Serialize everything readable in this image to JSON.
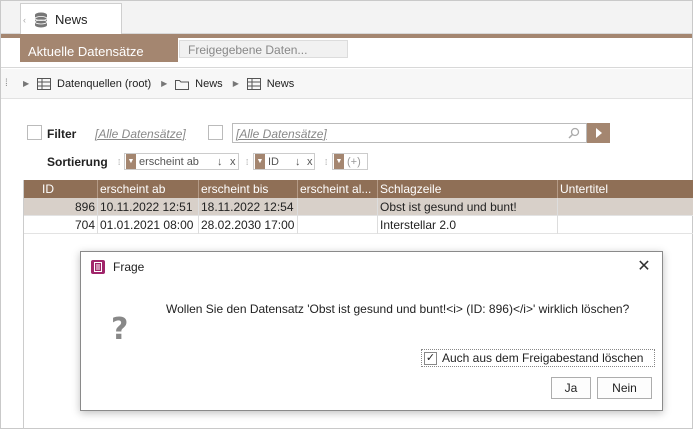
{
  "tab": {
    "label": "News"
  },
  "subtabs": {
    "active": "Aktuelle Datensätze",
    "inactive": "Freigegebene Daten..."
  },
  "breadcrumb": {
    "root": "Datenquellen (root)",
    "folder": "News",
    "table": "News"
  },
  "filter": {
    "label": "Filter",
    "dropdown_value": "[Alle Datensätze]",
    "search_value": "[Alle Datensätze]"
  },
  "sort": {
    "label": "Sortierung",
    "chip1": {
      "field": "erscheint ab",
      "dir": "↓",
      "close": "x"
    },
    "chip2": {
      "field": "ID",
      "dir": "↓",
      "close": "x"
    },
    "chip3": {
      "field": "(+)"
    }
  },
  "table": {
    "headers": [
      "ID",
      "erscheint ab",
      "erscheint bis",
      "erscheint al...",
      "Schlagzeile",
      "Untertitel"
    ],
    "rows": [
      {
        "id": "896",
        "ab": "10.11.2022 12:51",
        "bis": "18.11.2022 12:54",
        "al": "",
        "headline": "Obst ist gesund und bunt!",
        "sub": ""
      },
      {
        "id": "704",
        "ab": "01.01.2021 08:00",
        "bis": "28.02.2030 17:00",
        "al": "",
        "headline": "Interstellar 2.0",
        "sub": ""
      }
    ]
  },
  "dialog": {
    "title": "Frage",
    "icon": "?",
    "message": "Wollen Sie den Datensatz 'Obst ist gesund und bunt!<i> (ID: 896)</i>' wirklich löschen?",
    "checkbox_label": "Auch aus dem Freigabestand löschen",
    "checkbox_mark": "✓",
    "yes": "Ja",
    "no": "Nein"
  },
  "colors": {
    "accent": "#a48670",
    "header": "#8f6f56",
    "selected_row": "#d8d0c9",
    "dialog_icon": "#a0256a"
  }
}
